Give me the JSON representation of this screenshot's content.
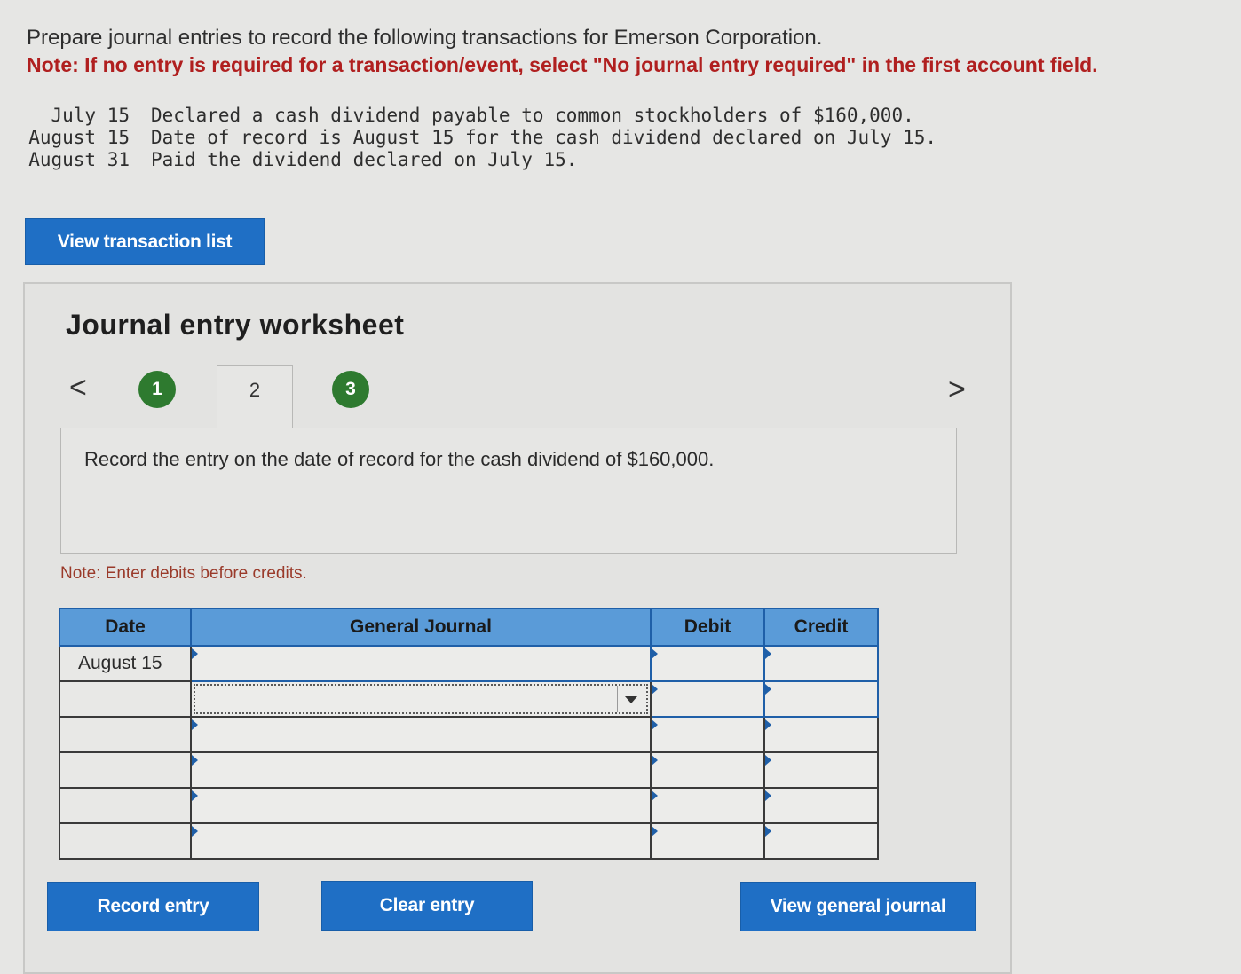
{
  "instructions": {
    "intro": "Prepare journal entries to record the following transactions for Emerson Corporation.",
    "note": "Note: If no entry is required for a transaction/event, select \"No journal entry required\" in the first account field."
  },
  "transactions": [
    {
      "date": "July 15",
      "description": "Declared a cash dividend payable to common stockholders of $160,000."
    },
    {
      "date": "August 15",
      "description": "Date of record is August 15 for the cash dividend declared on July 15."
    },
    {
      "date": "August 31",
      "description": "Paid the dividend declared on July 15."
    }
  ],
  "buttons": {
    "view_transaction_list": "View transaction list",
    "record_entry": "Record entry",
    "clear_entry": "Clear entry",
    "view_general_journal": "View general journal"
  },
  "worksheet": {
    "title": "Journal entry worksheet",
    "prev_arrow": "<",
    "next_arrow": ">",
    "steps": [
      "1",
      "2",
      "3"
    ],
    "active_step": "2",
    "instruction": "Record the entry on the date of record for the cash dividend of $160,000.",
    "note": "Note: Enter debits before credits."
  },
  "journal_table": {
    "headers": {
      "date": "Date",
      "general_journal": "General Journal",
      "debit": "Debit",
      "credit": "Credit"
    },
    "rows": [
      {
        "date": "August 15",
        "account": "",
        "debit": "",
        "credit": ""
      },
      {
        "date": "",
        "account": "",
        "debit": "",
        "credit": ""
      },
      {
        "date": "",
        "account": "",
        "debit": "",
        "credit": ""
      },
      {
        "date": "",
        "account": "",
        "debit": "",
        "credit": ""
      },
      {
        "date": "",
        "account": "",
        "debit": "",
        "credit": ""
      },
      {
        "date": "",
        "account": "",
        "debit": "",
        "credit": ""
      }
    ]
  },
  "colors": {
    "button_blue": "#1f6fc5",
    "header_blue": "#5a9bd8",
    "step_green": "#2e7a2f",
    "note_red": "#b01f1f"
  }
}
